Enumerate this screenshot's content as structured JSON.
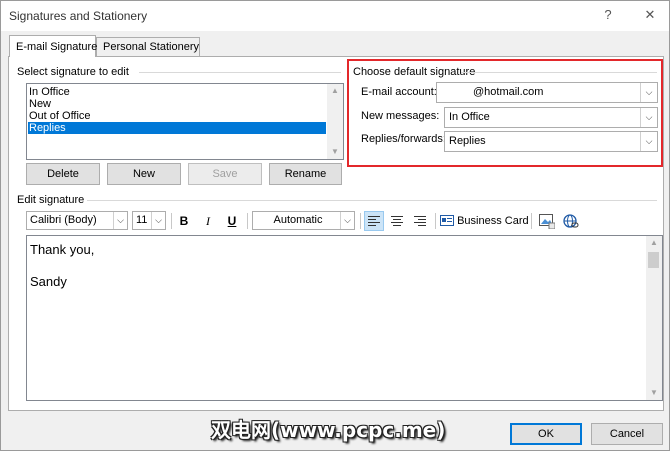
{
  "window": {
    "title": "Signatures and Stationery",
    "help": "?",
    "close": "✕"
  },
  "tabs": [
    {
      "label": "E-mail Signature",
      "active": true
    },
    {
      "label": "Personal Stationery",
      "active": false
    }
  ],
  "select_signature": {
    "heading": "Select signature to edit",
    "items": [
      "In Office",
      "New",
      "Out of Office",
      "Replies"
    ],
    "selected": "Replies",
    "scroll_up": "▲",
    "scroll_down": "▼"
  },
  "signature_buttons": {
    "delete": "Delete",
    "new": "New",
    "save": "Save",
    "rename": "Rename"
  },
  "default_signature": {
    "heading": "Choose default signature",
    "email_account_label": "E-mail account:",
    "email_account_value": "@hotmail.com",
    "new_messages_label": "New messages:",
    "new_messages_value": "In Office",
    "replies_label": "Replies/forwards:",
    "replies_value": "Replies",
    "highlight_color": "#e3282b"
  },
  "edit_signature": {
    "heading": "Edit signature",
    "font": "Calibri (Body)",
    "size": "11",
    "bold": "B",
    "italic": "I",
    "underline": "U",
    "color": "Automatic",
    "business_card": "Business Card",
    "body_lines": [
      "Thank you,",
      "",
      "Sandy"
    ]
  },
  "footer": {
    "ok": "OK",
    "cancel": "Cancel"
  },
  "watermark": "双电网(www.pcpc.me)"
}
